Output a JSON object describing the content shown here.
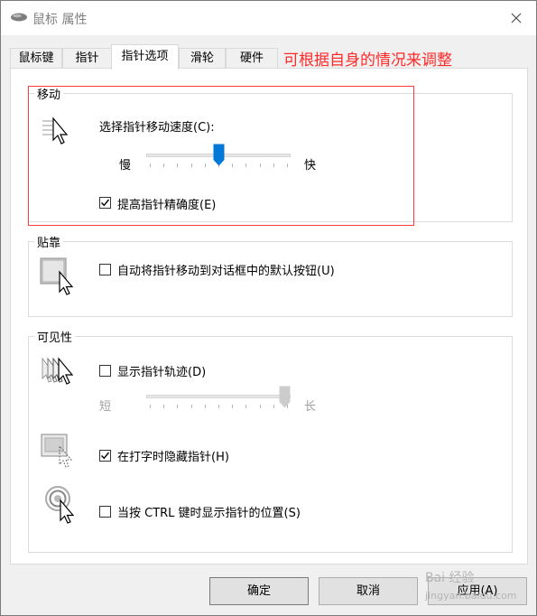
{
  "window": {
    "title": "鼠标 属性"
  },
  "tabs": [
    {
      "label": "鼠标键",
      "active": false
    },
    {
      "label": "指针",
      "active": false
    },
    {
      "label": "指针选项",
      "active": true
    },
    {
      "label": "滑轮",
      "active": false
    },
    {
      "label": "硬件",
      "active": false
    }
  ],
  "annotation": "可根据自身的情况来调整",
  "motion": {
    "legend": "移动",
    "speed_label": "选择指针移动速度(C):",
    "slow": "慢",
    "fast": "快",
    "speed_value": 0.5,
    "precision_label": "提高指针精确度(E)",
    "precision_checked": true
  },
  "snap": {
    "legend": "贴靠",
    "label": "自动将指针移动到对话框中的默认按钮(U)",
    "checked": false
  },
  "visibility": {
    "legend": "可见性",
    "trails_label": "显示指针轨迹(D)",
    "trails_checked": false,
    "short": "短",
    "long": "长",
    "trails_value": 1.0,
    "hide_label": "在打字时隐藏指针(H)",
    "hide_checked": true,
    "ctrl_label": "当按 CTRL 键时显示指针的位置(S)",
    "ctrl_checked": false
  },
  "buttons": {
    "ok": "确定",
    "cancel": "取消",
    "apply": "应用(A)"
  },
  "watermark": {
    "brand": "Bai 经验",
    "url": "jingyan.baidu.com"
  },
  "colors": {
    "accent": "#0078d7",
    "annotation": "#ff2a2a"
  }
}
